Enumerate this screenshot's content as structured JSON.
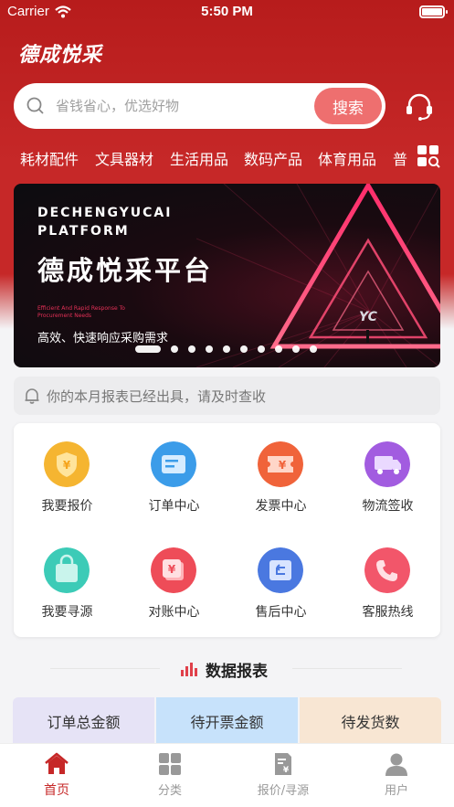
{
  "status_bar": {
    "carrier": "Carrier",
    "time": "5:50 PM"
  },
  "app": {
    "logo": "德成悦采"
  },
  "search": {
    "placeholder": "省钱省心，优选好物",
    "button_label": "搜索"
  },
  "categories": [
    "耗材配件",
    "文具器材",
    "生活用品",
    "数码产品",
    "体育用品",
    "普"
  ],
  "banner": {
    "title_en_1": "DECHENGYUCAI",
    "title_en_2": "PLATFORM",
    "title_cn": "德成悦采平台",
    "small_text_1": "Efficient And Rapid Response To",
    "small_text_2": "Procurement Needs",
    "subtitle": "高效、快速响应采购需求",
    "dots_total": 10,
    "active_dot": 0
  },
  "notice": {
    "text": "你的本月报表已经出具，请及时查收"
  },
  "functions": [
    {
      "label": "我要报价",
      "icon": "quote-shield-icon",
      "color": "#f5b531"
    },
    {
      "label": "订单中心",
      "icon": "order-card-icon",
      "color": "#3b9ce9"
    },
    {
      "label": "发票中心",
      "icon": "invoice-ticket-icon",
      "color": "#f0633a"
    },
    {
      "label": "物流签收",
      "icon": "truck-icon",
      "color": "#a25ce0"
    },
    {
      "label": "我要寻源",
      "icon": "shopping-bag-icon",
      "color": "#3ccbb7"
    },
    {
      "label": "对账中心",
      "icon": "reconcile-icon",
      "color": "#ee4c58"
    },
    {
      "label": "售后中心",
      "icon": "return-box-icon",
      "color": "#4a78e0"
    },
    {
      "label": "客服热线",
      "icon": "phone-icon",
      "color": "#f2566a"
    }
  ],
  "data_section": {
    "title": "数据报表"
  },
  "stats_tabs": [
    {
      "label": "订单总金额",
      "bg": "#e6e3f6"
    },
    {
      "label": "待开票金额",
      "bg": "#c7e2fb"
    },
    {
      "label": "待发货数",
      "bg": "#f8e6d3"
    }
  ],
  "tabbar": [
    {
      "label": "首页",
      "icon": "home-icon",
      "active": true
    },
    {
      "label": "分类",
      "icon": "category-grid-icon",
      "active": false
    },
    {
      "label": "报价/寻源",
      "icon": "quote-doc-icon",
      "active": false
    },
    {
      "label": "用户",
      "icon": "user-icon",
      "active": false
    }
  ],
  "colors": {
    "brand_red": "#c62828",
    "search_button": "#ee6f6f"
  }
}
